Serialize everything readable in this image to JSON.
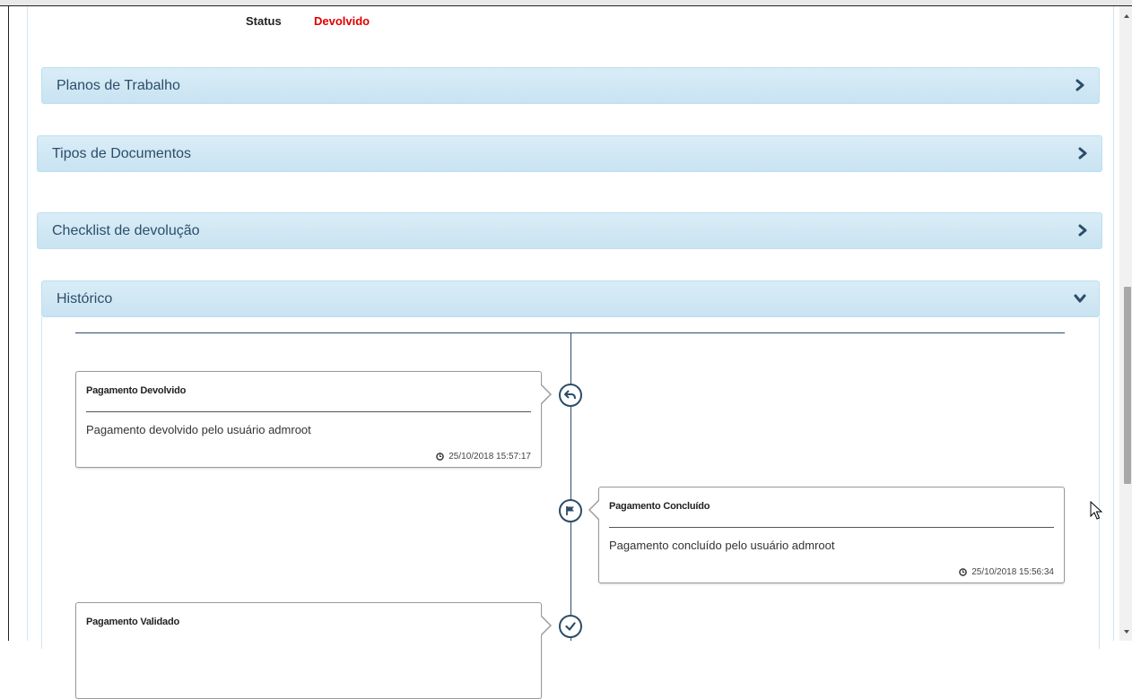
{
  "status": {
    "label": "Status",
    "value": "Devolvido",
    "value_color": "#e00000"
  },
  "panels": [
    {
      "title": "Planos de Trabalho",
      "icon": "chevron-right-icon",
      "expanded": false
    },
    {
      "title": "Tipos de Documentos",
      "icon": "chevron-right-icon",
      "expanded": false
    },
    {
      "title": "Checklist de devolução",
      "icon": "chevron-right-icon",
      "expanded": false
    },
    {
      "title": "Histórico",
      "icon": "chevron-down-icon",
      "expanded": true
    }
  ],
  "history": [
    {
      "title": "Pagamento Devolvido",
      "text": "Pagamento devolvido pelo usuário admroot",
      "time": "25/10/2018 15:57:17",
      "icon": "undo-arrow-icon",
      "side": "left"
    },
    {
      "title": "Pagamento Concluído",
      "text": "Pagamento concluído pelo usuário admroot",
      "time": "25/10/2018 15:56:34",
      "icon": "flag-icon",
      "side": "right"
    },
    {
      "title": "Pagamento Validado",
      "icon": "check-icon",
      "side": "left"
    }
  ],
  "colors": {
    "panel_bg": "#d9edf7",
    "panel_text": "#2c4d6a",
    "timeline": "#2c4d6a"
  }
}
